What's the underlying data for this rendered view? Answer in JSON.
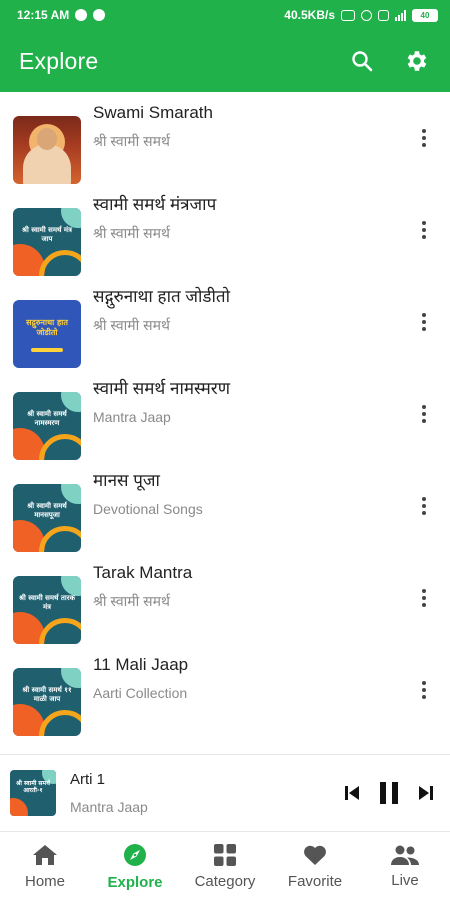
{
  "status_bar": {
    "time": "12:15 AM",
    "network_speed": "40.5KB/s",
    "battery": "40"
  },
  "app_bar": {
    "title": "Explore",
    "search_icon": "search-icon",
    "settings_icon": "gear-icon"
  },
  "list": {
    "items": [
      {
        "title": "Swami Smarath",
        "subtitle": "श्री स्वामी समर्थ",
        "thumb": "photo"
      },
      {
        "title": "स्वामी समर्थ मंत्रजाप",
        "subtitle": "श्री स्वामी समर्थ",
        "thumb": "teal",
        "thumb_text": "श्री स्वामी समर्थ मंत्र जाप"
      },
      {
        "title": "सद्गुरुनाथा हात जोडीतो",
        "subtitle": "श्री स्वामी समर्थ",
        "thumb": "blue",
        "thumb_text": "सद्गुरुनाथा हात जोडीतो"
      },
      {
        "title": "स्वामी समर्थ नामस्मरण",
        "subtitle": "Mantra Jaap",
        "thumb": "teal",
        "thumb_text": "श्री स्वामी समर्थ नामस्मरण"
      },
      {
        "title": "मानस पूजा",
        "subtitle": "Devotional Songs",
        "thumb": "teal",
        "thumb_text": "श्री स्वामी समर्थ मानसपूजा"
      },
      {
        "title": "Tarak Mantra",
        "subtitle": "श्री स्वामी समर्थ",
        "thumb": "teal",
        "thumb_text": "श्री स्वामी समर्थ तारक मंत्र"
      },
      {
        "title": "11 Mali Jaap",
        "subtitle": "Aarti Collection",
        "thumb": "teal",
        "thumb_text": "श्री स्वामी समर्थ ११ माळी जाप"
      }
    ]
  },
  "player": {
    "title": "Arti 1",
    "subtitle": "Mantra Jaap",
    "thumb_text": "श्री स्वामी समर्थ आरती-१"
  },
  "bottom_nav": {
    "items": [
      {
        "label": "Home",
        "icon": "home-icon",
        "active": false
      },
      {
        "label": "Explore",
        "icon": "compass-icon",
        "active": true
      },
      {
        "label": "Category",
        "icon": "grid-icon",
        "active": false
      },
      {
        "label": "Favorite",
        "icon": "heart-icon",
        "active": false
      },
      {
        "label": "Live",
        "icon": "people-icon",
        "active": false
      }
    ]
  },
  "colors": {
    "brand": "#21b14b",
    "inactive_nav": "#555555",
    "subtitle": "#8a8a8a"
  }
}
